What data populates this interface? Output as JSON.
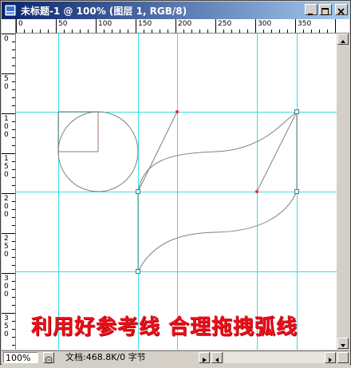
{
  "window": {
    "title": "未标题-1 @ 100% (图层 1, RGB/8)",
    "controls": {
      "minimize": "_",
      "maximize": "□",
      "close": "×"
    }
  },
  "rulers": {
    "top_ticks": [
      "0",
      "50",
      "100",
      "150",
      "200",
      "250",
      "300",
      "350"
    ],
    "left_ticks": [
      "0",
      "5\n0",
      "1\n0\n0",
      "1\n5\n0",
      "2\n0\n0",
      "2\n5\n0",
      "3\n0\n0",
      "3\n5\n0"
    ]
  },
  "canvas": {
    "caption": "利用好参考线 合理拖拽弧线",
    "guide_color": "#39e0e0",
    "path_color": "#808080",
    "caption_color": "#e8101a"
  },
  "statusbar": {
    "zoom": "100%",
    "doc_info": "文档:468.8K/0 字节"
  },
  "icons": [
    "photoshop-doc-icon",
    "minimize-icon",
    "maximize-icon",
    "close-icon",
    "zoom-options-icon",
    "play-arrow-icon",
    "scroll-left-icon",
    "scroll-right-icon",
    "scroll-up-icon",
    "scroll-down-icon"
  ]
}
